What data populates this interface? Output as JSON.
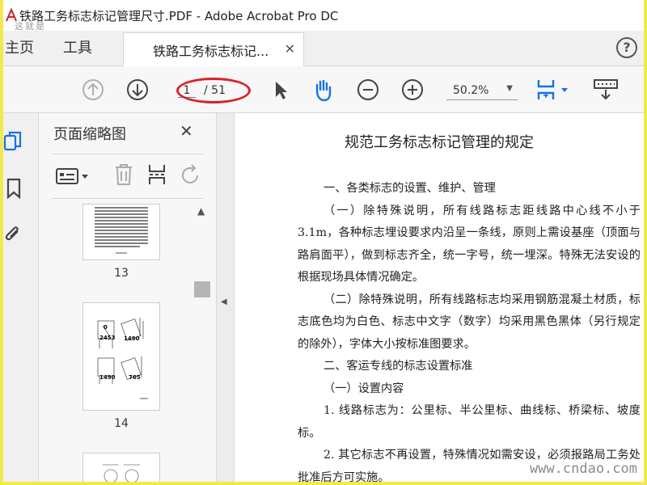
{
  "window": {
    "title": "铁路工务标志标记管理尺寸.PDF - Adobe Acrobat Pro DC",
    "app_icon": "acrobat-icon",
    "top_watermark": "这就是"
  },
  "tabs": {
    "home": "主页",
    "tools": "工具",
    "document": "铁路工务标志标记...",
    "help": "?"
  },
  "toolbar": {
    "current_page": "1",
    "total_pages": "/ 51",
    "zoom": "50.2%"
  },
  "panel": {
    "title": "页面缩略图",
    "thumbnails": [
      {
        "label": "13"
      },
      {
        "label": "14"
      }
    ],
    "thumb14_marks": [
      "0",
      "2453",
      "1490",
      "1490",
      "765"
    ]
  },
  "document": {
    "title": "规范工务标志标记管理的规定",
    "paragraphs": [
      "一、各类标志的设置、维护、管理",
      "（一）除特殊说明，所有线路标志距线路中心线不小于 3.1m，各种标志埋设要求内沿呈一条线，原则上需设基座（顶面与路肩面平），做到标志齐全，统一字号，统一埋深。特殊无法安设的根据现场具体情况确定。",
      "（二）除特殊说明，所有线路标志均采用钢筋混凝土材质，标志底色均为白色、标志中文字（数字）均采用黑色黑体（另行规定的除外），字体大小按标准图要求。",
      "二、客运专线的标志设置标准",
      "（一）设置内容",
      "1. 线路标志为：公里标、半公里标、曲线标、桥梁标、坡度标。",
      "2. 其它标志不再设置，特殊情况如需安设，必须报路局工务处批准后方可实施。"
    ],
    "watermark": "www.cndao.com"
  },
  "colors": {
    "annotation_red": "#d8222a",
    "accent_blue": "#1473e6",
    "frame_yellow": "#f4e94a"
  }
}
